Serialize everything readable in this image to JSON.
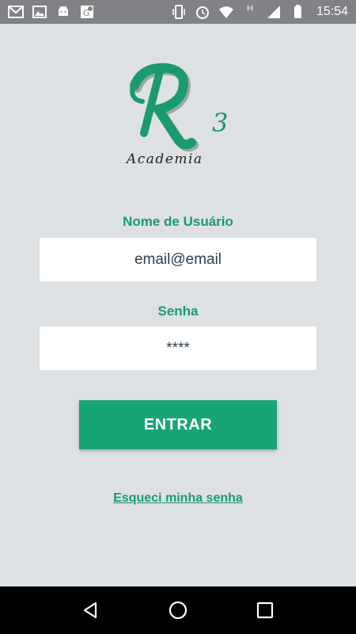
{
  "status_bar": {
    "time": "15:54",
    "signal_h": "H",
    "left_icons": [
      "gmail-icon",
      "image-icon",
      "android-icon",
      "maps-icon"
    ],
    "right_icons": [
      "vibrate-icon",
      "alarm-icon",
      "wifi-icon",
      "signal-icon",
      "battery-icon"
    ]
  },
  "logo": {
    "letter": "R",
    "superscript": "3",
    "subtitle": "Academia",
    "color": "#1a9a6e"
  },
  "form": {
    "username_label": "Nome de Usuário",
    "username_value": "email@email",
    "password_label": "Senha",
    "password_value": "****",
    "submit_label": "ENTRAR",
    "forgot_label": "Esqueci minha senha"
  },
  "nav_bar": {
    "buttons": [
      "back-icon",
      "home-icon",
      "recents-icon"
    ]
  },
  "colors": {
    "accent": "#17a476",
    "background": "#dde1e4",
    "status_bar": "#808285"
  }
}
